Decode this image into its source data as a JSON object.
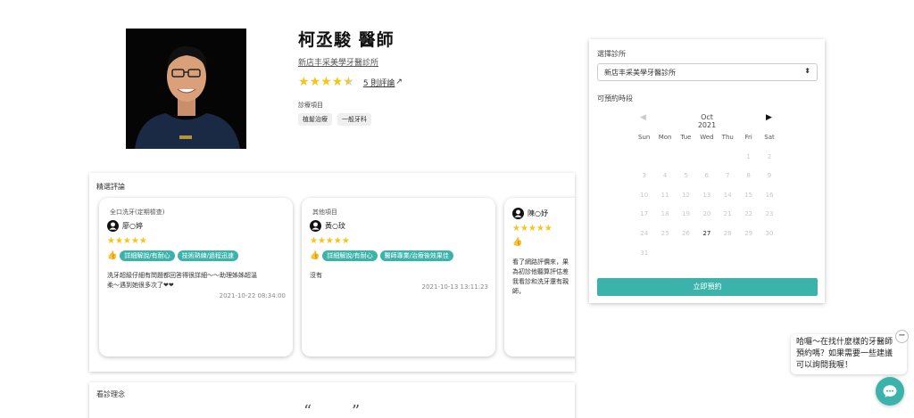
{
  "doctor": {
    "name": "柯丞駿 醫師",
    "clinic": "新店丰采美學牙醫診所",
    "stars": "★★★★★",
    "review_link": "5 則評論",
    "services_label": "診療項目",
    "services": [
      "植髮治療",
      "一般牙科"
    ]
  },
  "reviews": {
    "title": "精選評論",
    "cards": [
      {
        "category": "全口洗牙(定期檢查)",
        "user": "廖○婷",
        "stars": "★★★★★",
        "thumb": "👍",
        "tags": [
          "詳細解說/有耐心",
          "技術熟練/過程迅速"
        ],
        "text_lines": [
          "洗牙超級仔細有問題都回答得很詳細～～助理姊姊超溫",
          "柔～遇到她很多次了❤❤"
        ],
        "time": "2021-10-22 08:34:00"
      },
      {
        "category": "其他項目",
        "user": "黃○玟",
        "stars": "★★★★★",
        "thumb": "👍",
        "tags": [
          "詳細解說/有耐心",
          "醫師專業/治療後效果佳"
        ],
        "text_lines": [
          "沒有"
        ],
        "time": "2021-10-13 13:11:23"
      },
      {
        "user": "陳○妤",
        "stars": "★★★★★",
        "thumb": "👍",
        "text_lines": [
          "看了網路評價來，果",
          "為初診他聽算評估差",
          "我看診和洗牙還有親",
          "師，"
        ]
      }
    ]
  },
  "philosophy": {
    "title": "看診理念",
    "open_quote": "“",
    "close_quote": "”"
  },
  "booking": {
    "clinic_label": "選擇診所",
    "clinic_value": "新店丰采美學牙醫診所",
    "caret": "⬍",
    "time_label": "可預約時段",
    "prev": "◀",
    "month": "Oct 2021",
    "next": "▶",
    "weekdays": [
      "Sun",
      "Mon",
      "Tue",
      "Wed",
      "Thu",
      "Fri",
      "Sat"
    ],
    "days": [
      "",
      "",
      "",
      "",
      "",
      "1",
      "2",
      "3",
      "4",
      "5",
      "6",
      "7",
      "8",
      "9",
      "10",
      "11",
      "12",
      "13",
      "14",
      "15",
      "16",
      "17",
      "18",
      "19",
      "20",
      "21",
      "22",
      "23",
      "24",
      "25",
      "26",
      "27",
      "28",
      "29",
      "30",
      "31"
    ],
    "available_days": [
      "27"
    ],
    "button": "立即預約"
  },
  "chat": {
    "message": "哈囉～在找什麼樣的牙醫師預約嗎？如果需要一些建議可以詢問我喔！",
    "close": "−"
  },
  "colors": {
    "accent": "#3bb3aa",
    "star": "#f5c518"
  }
}
